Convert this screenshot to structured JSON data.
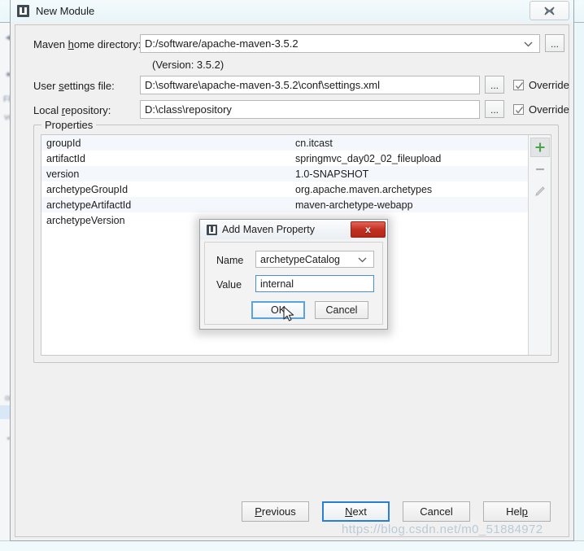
{
  "window": {
    "title": "New Module",
    "icon": "intellij-idea-icon",
    "close_label": "Close"
  },
  "form": {
    "maven_home": {
      "label_pre": "Maven ",
      "label_accel": "h",
      "label_post": "ome directory:",
      "value": "D:/software/apache-maven-3.5.2",
      "browse_label": "...",
      "version_note": "(Version: 3.5.2)"
    },
    "user_settings": {
      "label_pre": "User ",
      "label_accel": "s",
      "label_post": "ettings file:",
      "value": "D:\\software\\apache-maven-3.5.2\\conf\\settings.xml",
      "browse_label": "...",
      "override_label": "Override",
      "override_checked": true
    },
    "local_repository": {
      "label_pre": "Local ",
      "label_accel": "r",
      "label_post": "epository:",
      "value": "D:\\class\\repository",
      "browse_label": "...",
      "override_label": "Override",
      "override_checked": true
    }
  },
  "properties_group": {
    "title": "Properties",
    "rows": [
      {
        "key": "groupId",
        "value": "cn.itcast"
      },
      {
        "key": "artifactId",
        "value": "springmvc_day02_02_fileupload"
      },
      {
        "key": "version",
        "value": "1.0-SNAPSHOT"
      },
      {
        "key": "archetypeGroupId",
        "value": "org.apache.maven.archetypes"
      },
      {
        "key": "archetypeArtifactId",
        "value": "maven-archetype-webapp"
      },
      {
        "key": "archetypeVersion",
        "value": ""
      }
    ],
    "toolbar": {
      "add_label": "Add property",
      "remove_label": "Remove property",
      "edit_label": "Edit property"
    }
  },
  "footer": {
    "buttons": [
      {
        "name": "previous",
        "pre": "",
        "accel": "P",
        "post": "revious",
        "focused": false
      },
      {
        "name": "next",
        "pre": "",
        "accel": "N",
        "post": "ext",
        "focused": true
      },
      {
        "name": "cancel",
        "pre": "Cancel",
        "accel": "",
        "post": "",
        "focused": false
      },
      {
        "name": "help",
        "pre": "Hel",
        "accel": "p",
        "post": "",
        "focused": false
      }
    ]
  },
  "modal": {
    "title": "Add Maven Property",
    "icon": "intellij-idea-icon",
    "close_label": "x",
    "name_label": "Name",
    "name_value": "archetypeCatalog",
    "value_label": "Value",
    "value_value": "internal",
    "ok_label": "OK",
    "cancel_label": "Cancel"
  },
  "watermark": {
    "text": "https://blog.csdn.net/m0_51884972"
  },
  "colors": {
    "accent_focus": "#2a7fd4",
    "close_red": "#c12f20",
    "add_green": "#47a447",
    "row_stripe": "#f4f7fb",
    "dialog_bg": "#f0f0f0"
  }
}
